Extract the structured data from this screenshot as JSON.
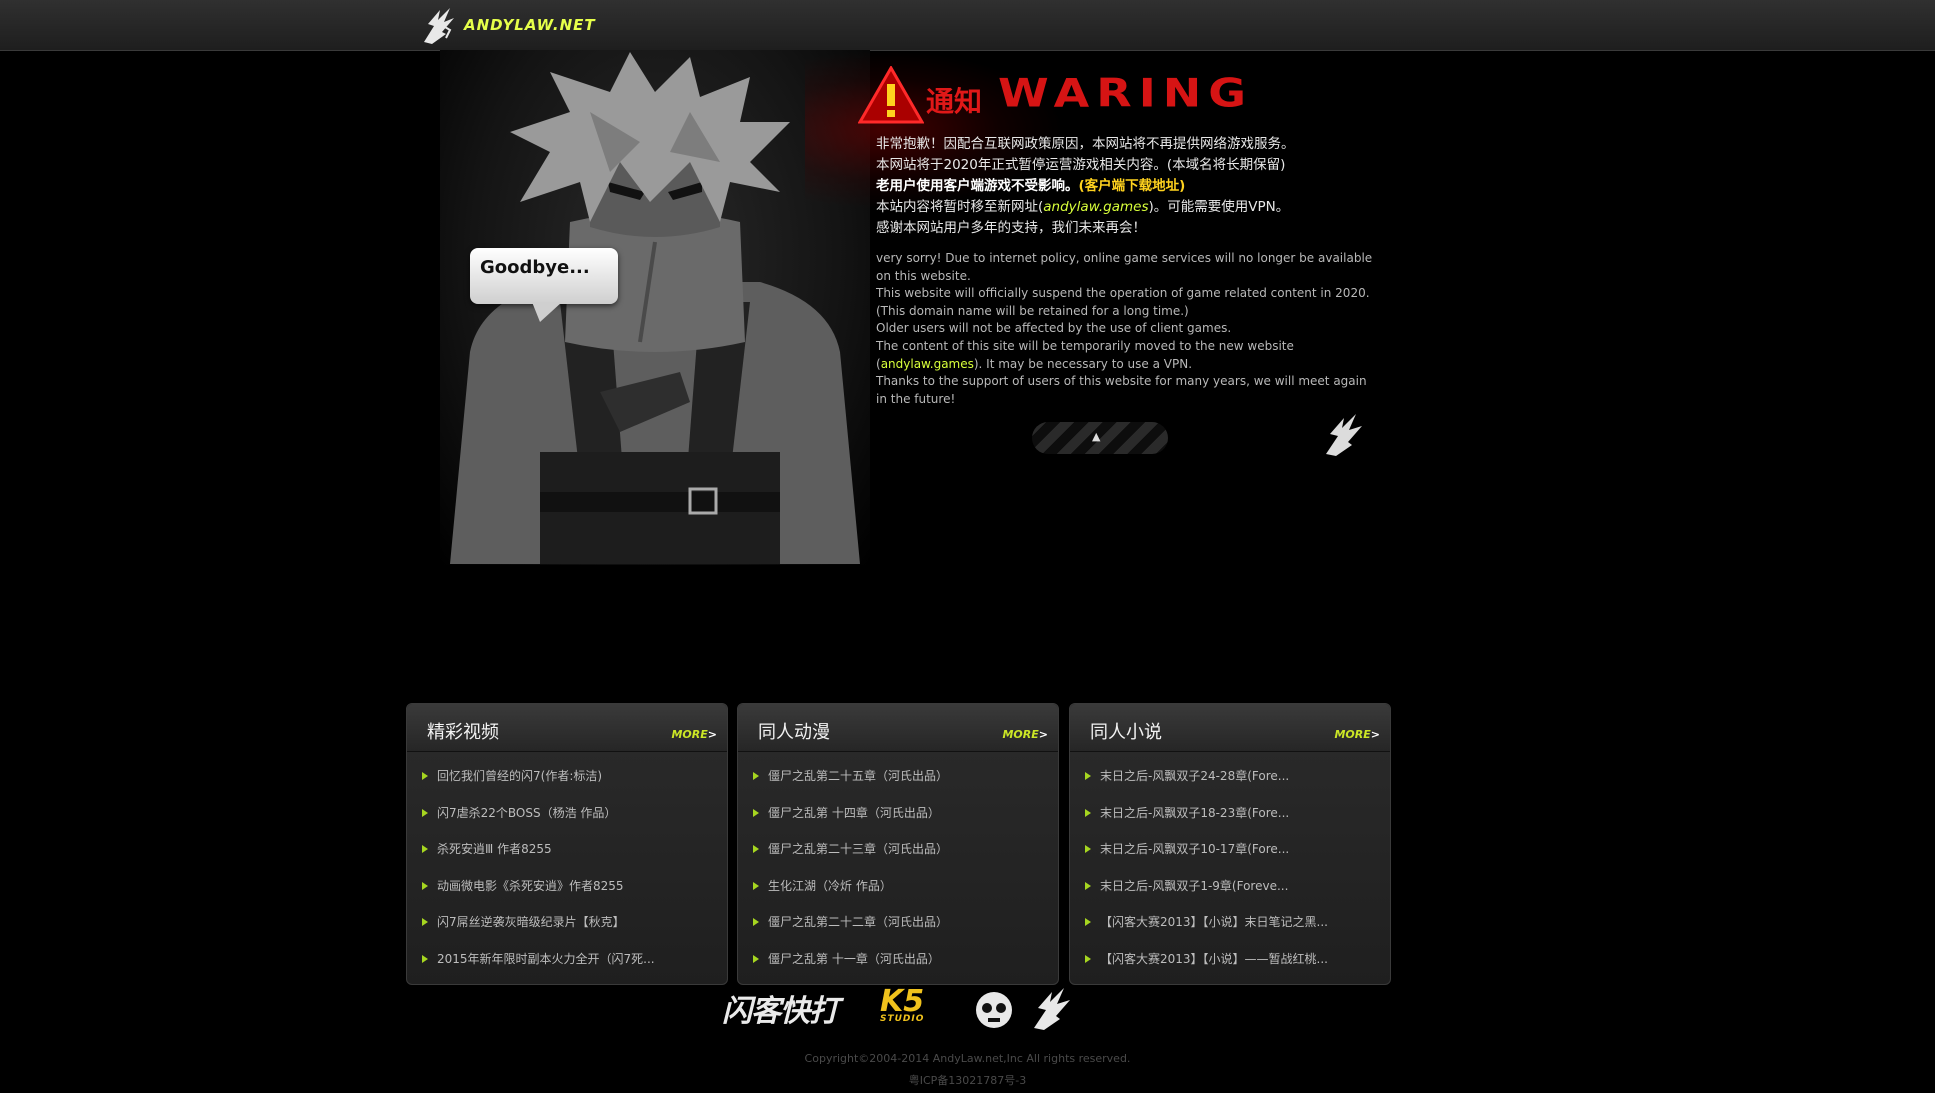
{
  "header": {
    "logo_text": "ANDYLAW.NET"
  },
  "hero": {
    "bubble_text": "Goodbye...",
    "notice_cn": "通知",
    "notice_en": "WARING",
    "cn_lines": [
      "非常抱歉！因配合互联网政策原因，本网站将不再提供网络游戏服务。",
      "本网站将于2020年正式暂停运营游戏相关内容。(本域名将长期保留)",
      "老用户使用客户端游戏不受影响。",
      "(客户端下载地址)",
      "本站内容将暂时移至新网址(",
      "andylaw.games",
      ")。可能需要使用VPN。",
      "感谢本网站用户多年的支持，我们未来再会！"
    ],
    "en_lines": [
      "very sorry! Due to internet policy, online game services will no longer be available on this website.",
      "This website will officially suspend the operation of game related content in 2020.",
      "(This domain name will be retained for a long time.)",
      "Older users will not be affected by the use of client games.",
      "The content of this site will be temporarily moved to the new website (",
      "andylaw.games",
      "). It may be necessary to use a VPN.",
      "Thanks to the support of users of this website for many years, we will meet again in the future!"
    ],
    "button_arrow": "▲"
  },
  "panels": [
    {
      "title": "精彩视频",
      "more": "MORE",
      "more_arrow": ">",
      "items": [
        "回忆我们曾经的闪7(作者:标洁)",
        "闪7虐杀22个BOSS（杨浩 作品）",
        "杀死安逍Ⅲ 作者8255",
        "动画微电影《杀死安逍》作者8255",
        "闪7屌丝逆袭灰暗级纪录片【秋克】",
        "2015年新年限时副本火力全开（闪7死..."
      ]
    },
    {
      "title": "同人动漫",
      "more": "MORE",
      "more_arrow": ">",
      "items": [
        "僵尸之乱第二十五章（河氏出品）",
        "僵尸之乱第 十四章（河氏出品）",
        "僵尸之乱第二十三章（河氏出品）",
        "生化江湖（冷炘 作品）",
        "僵尸之乱第二十二章（河氏出品）",
        "僵尸之乱第 十一章（河氏出品）"
      ]
    },
    {
      "title": "同人小说",
      "more": "MORE",
      "more_arrow": ">",
      "items": [
        "末日之后-风飘双子24-28章(Fore...",
        "末日之后-风飘双子18-23章(Fore...",
        "末日之后-风飘双子10-17章(Fore...",
        "末日之后-风飘双子1-9章(Foreve...",
        "【闪客大赛2013】【小说】末日笔记之黑...",
        "【闪客大赛2013】【小说】——暂战红桃..."
      ]
    }
  ],
  "footer": {
    "brand_flash": "闪客快打",
    "brand_k5": "K5",
    "brand_k5_sub": "STUDIO",
    "copyright": "Copyright©2004-2014 AndyLaw.net,Inc All rights reserved.",
    "icp": "粤ICP备13021787号-3"
  }
}
